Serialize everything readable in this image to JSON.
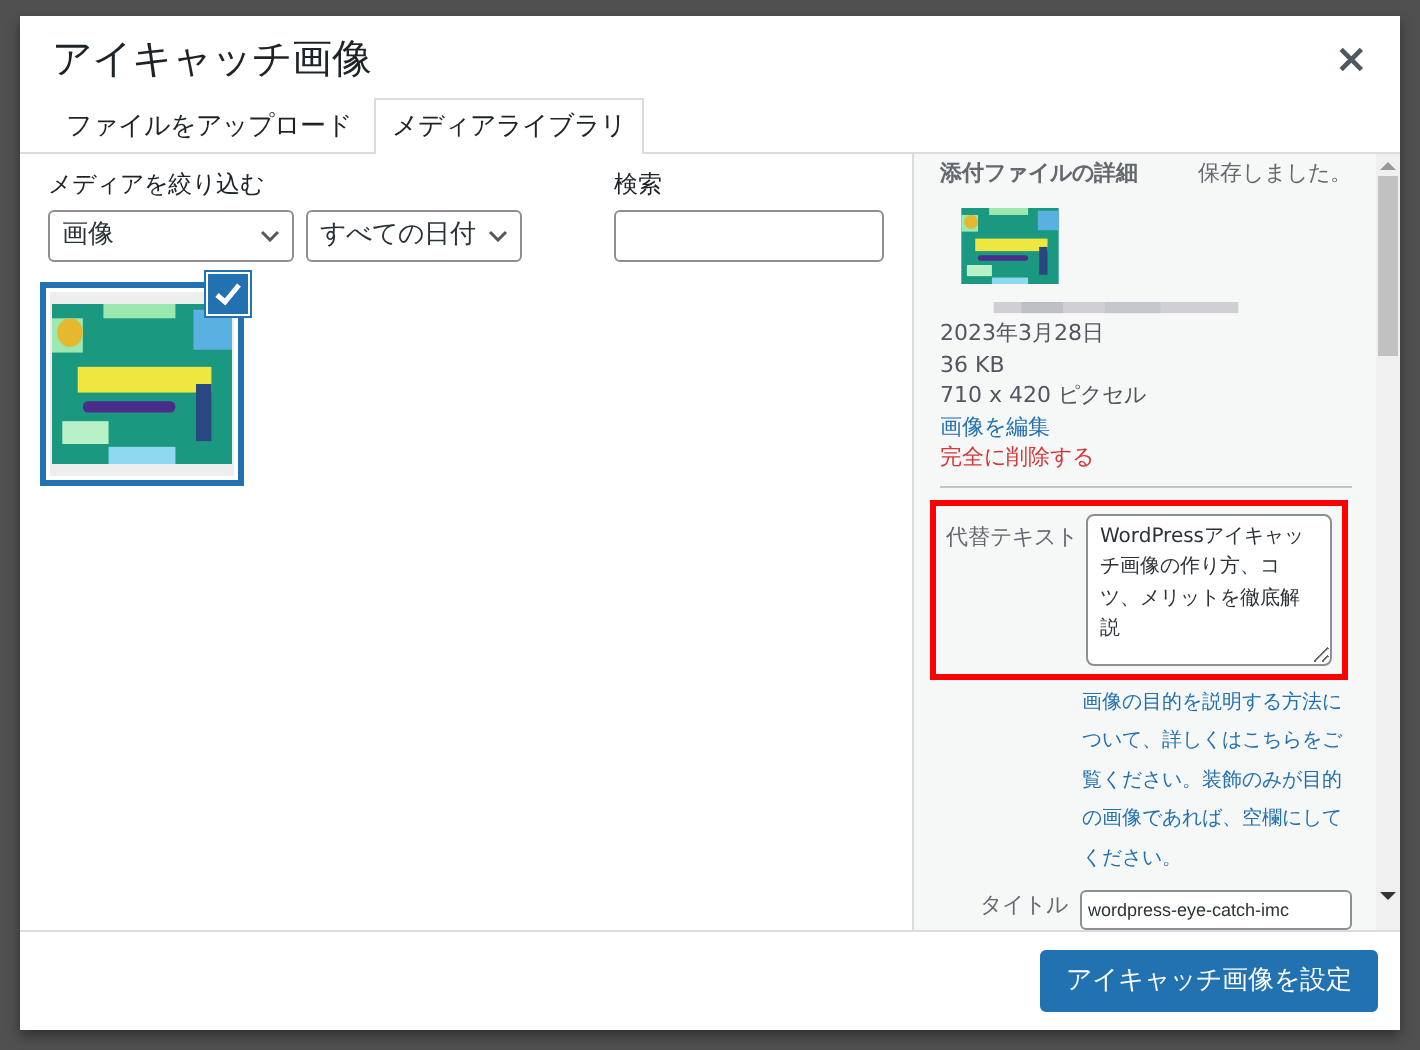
{
  "dialog": {
    "title": "アイキャッチ画像",
    "close": "×"
  },
  "tabs": [
    {
      "label": "ファイルをアップロード",
      "selected": false
    },
    {
      "label": "メディアライブラリ",
      "selected": true
    }
  ],
  "filter": {
    "label": "メディアを絞り込む",
    "type": "画像",
    "date": "すべての日付"
  },
  "search": {
    "label": "検索"
  },
  "attachments": [
    {
      "kind": "picture",
      "selected": true
    }
  ],
  "details": {
    "heading": "添付ファイルの詳細",
    "status": "保存しました。",
    "date": "2023年3月28日",
    "size": "36 KB",
    "dimensions": "710 x 420 ピクセル",
    "edit_link": "画像を編集",
    "delete_link": "完全に削除する",
    "alt_label": "代替テキスト",
    "alt_text": "WordPressアイキャッチ画像の作り方、コツ、メリットを徹底解説",
    "alt_highlighted": true,
    "help": "画像の目的を説明する方法について、詳しくはこちらをご覧ください。装飾のみが目的の画像であれば、空欄にしてください。",
    "title_label": "タイトル",
    "title_value": "wordpress-eye-catch-imc"
  },
  "footer": {
    "button": "アイキャッチ画像を設定"
  }
}
